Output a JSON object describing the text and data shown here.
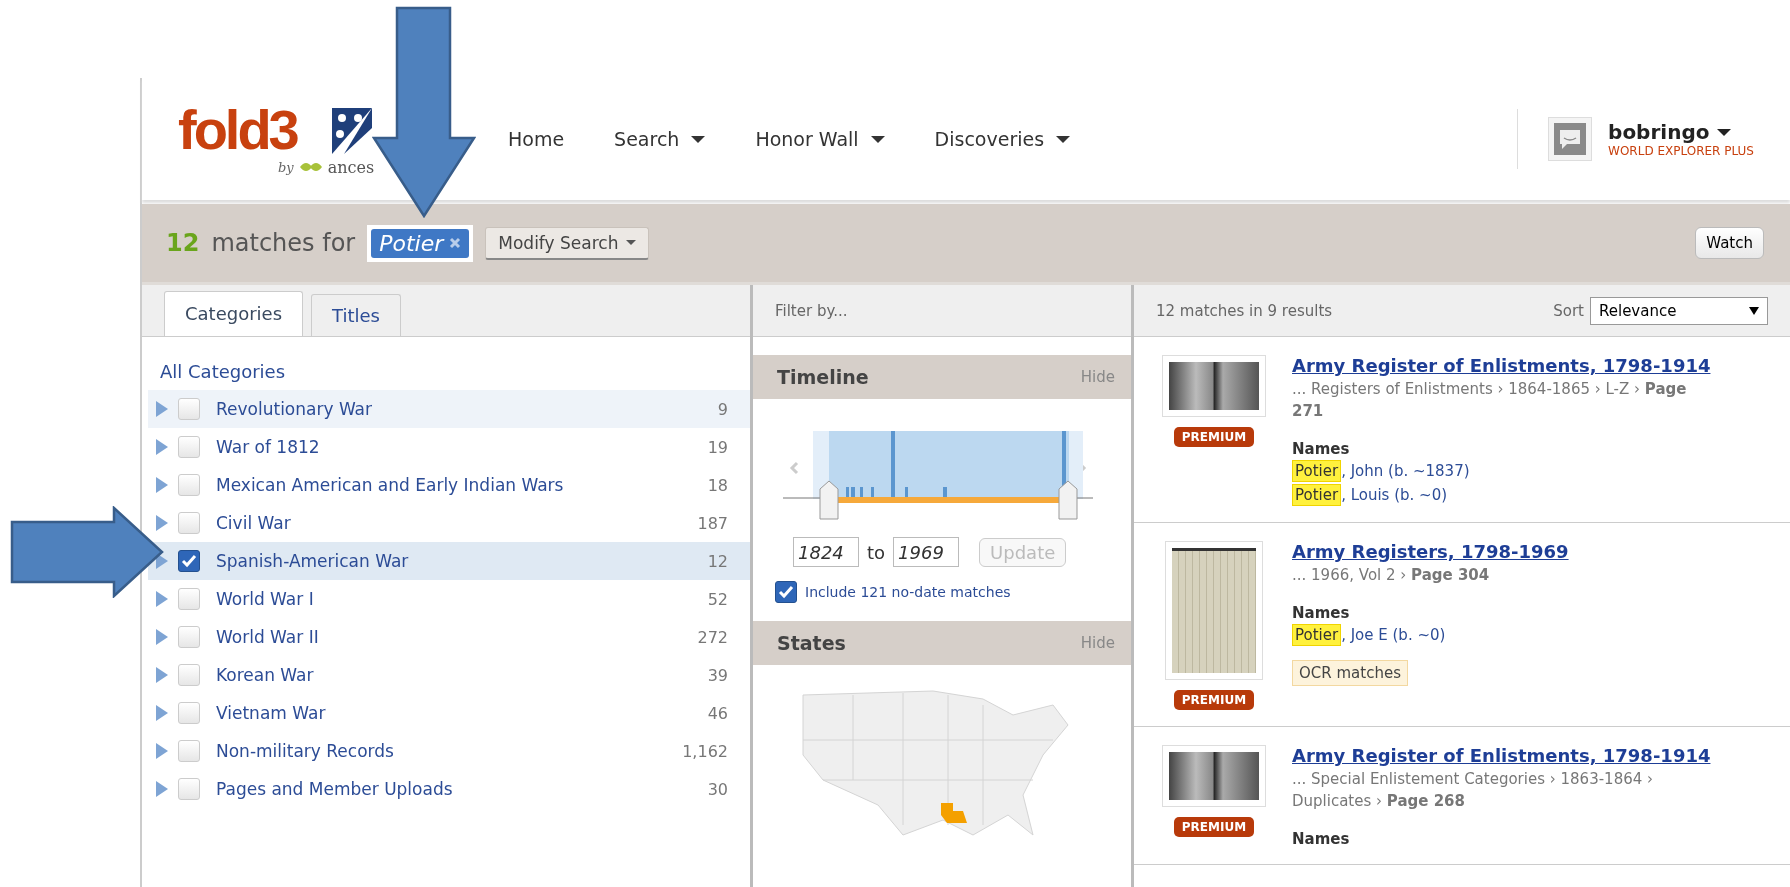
{
  "header": {
    "logo": {
      "wordmark": "fold3",
      "by": "by",
      "partner": "ances"
    },
    "nav": [
      {
        "label": "Home",
        "dropdown": false
      },
      {
        "label": "Search",
        "dropdown": true
      },
      {
        "label": "Honor Wall",
        "dropdown": true
      },
      {
        "label": "Discoveries",
        "dropdown": true
      }
    ],
    "user": {
      "name": "bobringo",
      "plan": "WORLD EXPLORER PLUS"
    }
  },
  "search_bar": {
    "count": "12",
    "text": "matches for",
    "term": "Potier",
    "modify": "Modify Search",
    "watch": "Watch"
  },
  "tabs": [
    {
      "label": "Categories",
      "selected": true
    },
    {
      "label": "Titles",
      "selected": false
    }
  ],
  "filter_label": "Filter by...",
  "results_summary": "12 matches in 9 results",
  "sort": {
    "label": "Sort",
    "value": "Relevance"
  },
  "categories": {
    "all": "All Categories",
    "items": [
      {
        "label": "Revolutionary War",
        "count": "9",
        "checked": false,
        "hovered": true
      },
      {
        "label": "War of 1812",
        "count": "19",
        "checked": false,
        "hovered": false
      },
      {
        "label": "Mexican American and Early Indian Wars",
        "count": "18",
        "checked": false,
        "hovered": false
      },
      {
        "label": "Civil War",
        "count": "187",
        "checked": false,
        "hovered": false
      },
      {
        "label": "Spanish-American War",
        "count": "12",
        "checked": true,
        "hovered": false
      },
      {
        "label": "World War I",
        "count": "52",
        "checked": false,
        "hovered": false
      },
      {
        "label": "World War II",
        "count": "272",
        "checked": false,
        "hovered": false
      },
      {
        "label": "Korean War",
        "count": "39",
        "checked": false,
        "hovered": false
      },
      {
        "label": "Vietnam War",
        "count": "46",
        "checked": false,
        "hovered": false
      },
      {
        "label": "Non-military Records",
        "count": "1,162",
        "checked": false,
        "hovered": false
      },
      {
        "label": "Pages and Member Uploads",
        "count": "30",
        "checked": false,
        "hovered": false
      }
    ]
  },
  "timeline": {
    "title": "Timeline",
    "hide": "Hide",
    "from": "1824",
    "separator": "to",
    "to": "1969",
    "update": "Update",
    "include": {
      "label": "Include 121 no-date matches",
      "checked": true
    }
  },
  "states": {
    "title": "States",
    "hide": "Hide"
  },
  "results": [
    {
      "kind": "spread",
      "title": "Army Register of Enlistments, 1798-1914",
      "path": "... Registers of Enlistments › 1864-1865 › L-Z › **Page 271**",
      "badge": "PREMIUM",
      "names_label": "Names",
      "names": [
        {
          "surname": "Potier",
          "rest": ", John (b. ~1837)"
        },
        {
          "surname": "Potier",
          "rest": ", Louis (b. ~0)"
        }
      ]
    },
    {
      "kind": "page",
      "title": "Army Registers, 1798-1969",
      "path": "... 1966, Vol 2 › **Page 304**",
      "badge": "PREMIUM",
      "names_label": "Names",
      "names": [
        {
          "surname": "Potier",
          "rest": ", Joe E (b. ~0)"
        }
      ],
      "ocr": "OCR matches"
    },
    {
      "kind": "spread",
      "title": "Army Register of Enlistments, 1798-1914",
      "path": "... Special Enlistement Categories › 1863-1864 › Duplicates › **Page 268**",
      "badge": "PREMIUM",
      "names_label": "Names"
    }
  ],
  "annotations": [
    {
      "kind": "down"
    },
    {
      "kind": "right"
    }
  ]
}
